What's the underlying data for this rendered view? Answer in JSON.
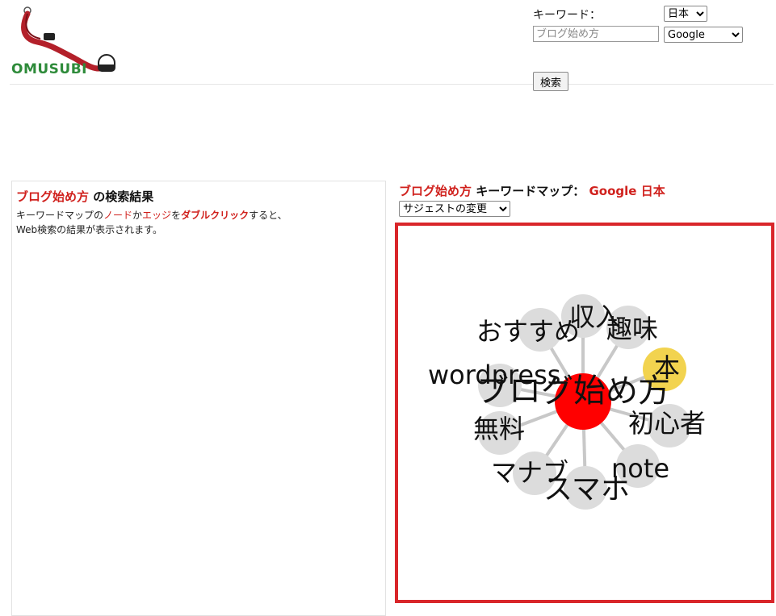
{
  "header": {
    "logo_text": "OMUSUBI",
    "keyword_label": "キーワード：",
    "keyword_placeholder": "ブログ始め方",
    "country_selected": "日本",
    "engine_selected": "Google",
    "search_button": "検索"
  },
  "results": {
    "keyword": "ブログ始め方",
    "title_suffix": " の検索結果",
    "desc": {
      "part1": "キーワードマップの",
      "node": "ノード",
      "part2": "か",
      "edge": "エッジ",
      "part3": "を",
      "dblclick": "ダブルクリック",
      "part4": "すると、",
      "line2": "Web検索の結果が表示されます。"
    }
  },
  "keyword_map": {
    "keyword": "ブログ始め方",
    "label": " キーワードマップ：",
    "engine": "Google",
    "country": "日本",
    "suggest_option": "サジェストの変更",
    "center_label": "ブログ始め方",
    "nodes": [
      {
        "label": "収入"
      },
      {
        "label": "趣味"
      },
      {
        "label": "本"
      },
      {
        "label": "初心者"
      },
      {
        "label": "note"
      },
      {
        "label": "スマホ"
      },
      {
        "label": "マナブ"
      },
      {
        "label": "無料"
      },
      {
        "label": "wordpress"
      },
      {
        "label": "おすすめ"
      }
    ],
    "colors": {
      "center": "#ff0000",
      "highlight": "#f2d34f",
      "node": "#dcdcdc",
      "edge": "#c8c8c8",
      "frame": "#d9262a"
    }
  }
}
